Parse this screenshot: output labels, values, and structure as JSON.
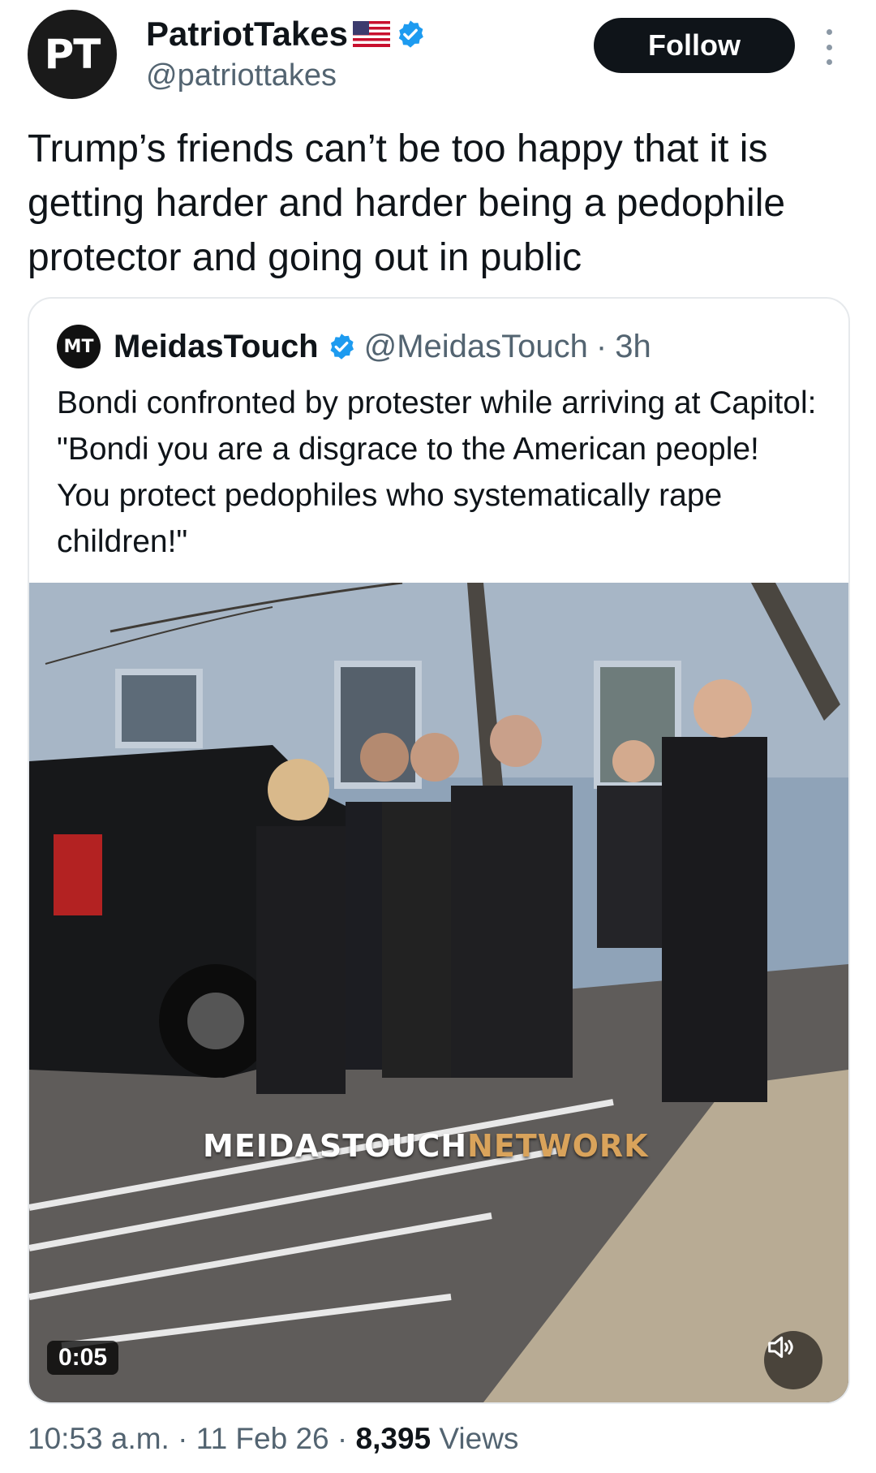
{
  "author": {
    "avatar_initials": "PT",
    "display_name": "PatriotTakes",
    "flag_icon": "us-flag-icon",
    "verified_icon": "verified-badge-icon",
    "handle": "@patriottakes"
  },
  "follow_label": "Follow",
  "more_icon": "more-options-icon",
  "tweet_text": "Trump’s friends can’t be too happy that it is  getting harder and harder being a pedophile protector and going out in public",
  "quote": {
    "avatar_initials": "MT",
    "display_name": "MeidasTouch",
    "handle": "@MeidasTouch",
    "separator": "·",
    "time": "3h",
    "text": "Bondi confronted by protester while arriving at Capitol: \"Bondi you are a disgrace to the American people! You protect pedophiles who systematically rape children!\"",
    "video": {
      "watermark_main": "MEIDASTOUCH",
      "watermark_accent": "NETWORK",
      "duration": "0:05",
      "mute_icon": "speaker-icon"
    }
  },
  "meta": {
    "time": "10:53 a.m.",
    "sep1": " · ",
    "date": "11 Feb 26",
    "sep2": " · ",
    "views_count": "8,395",
    "views_label": " Views"
  },
  "colors": {
    "accent_blue": "#1d9bf0",
    "text": "#0f1419",
    "secondary": "#536471"
  }
}
